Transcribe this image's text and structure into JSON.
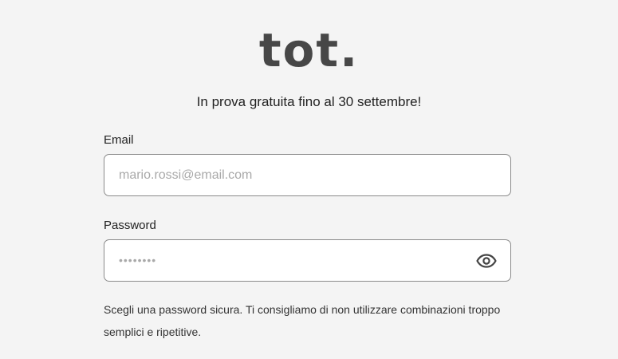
{
  "brand": {
    "logo_text": "tot."
  },
  "tagline": "In prova gratuita fino al 30 settembre!",
  "form": {
    "email": {
      "label": "Email",
      "placeholder": "mario.rossi@email.com",
      "value": ""
    },
    "password": {
      "label": "Password",
      "placeholder": "••••••••",
      "value": "",
      "toggle_icon": "eye-icon"
    },
    "hint": "Scegli una password sicura. Ti consigliamo di non utilizzare combinazioni troppo semplici e ripetitive."
  },
  "colors": {
    "background": "#f4f4f4",
    "logo": "#474747",
    "input_border": "#8a8a8a",
    "input_background": "#ffffff",
    "placeholder": "#a9a9a9"
  }
}
